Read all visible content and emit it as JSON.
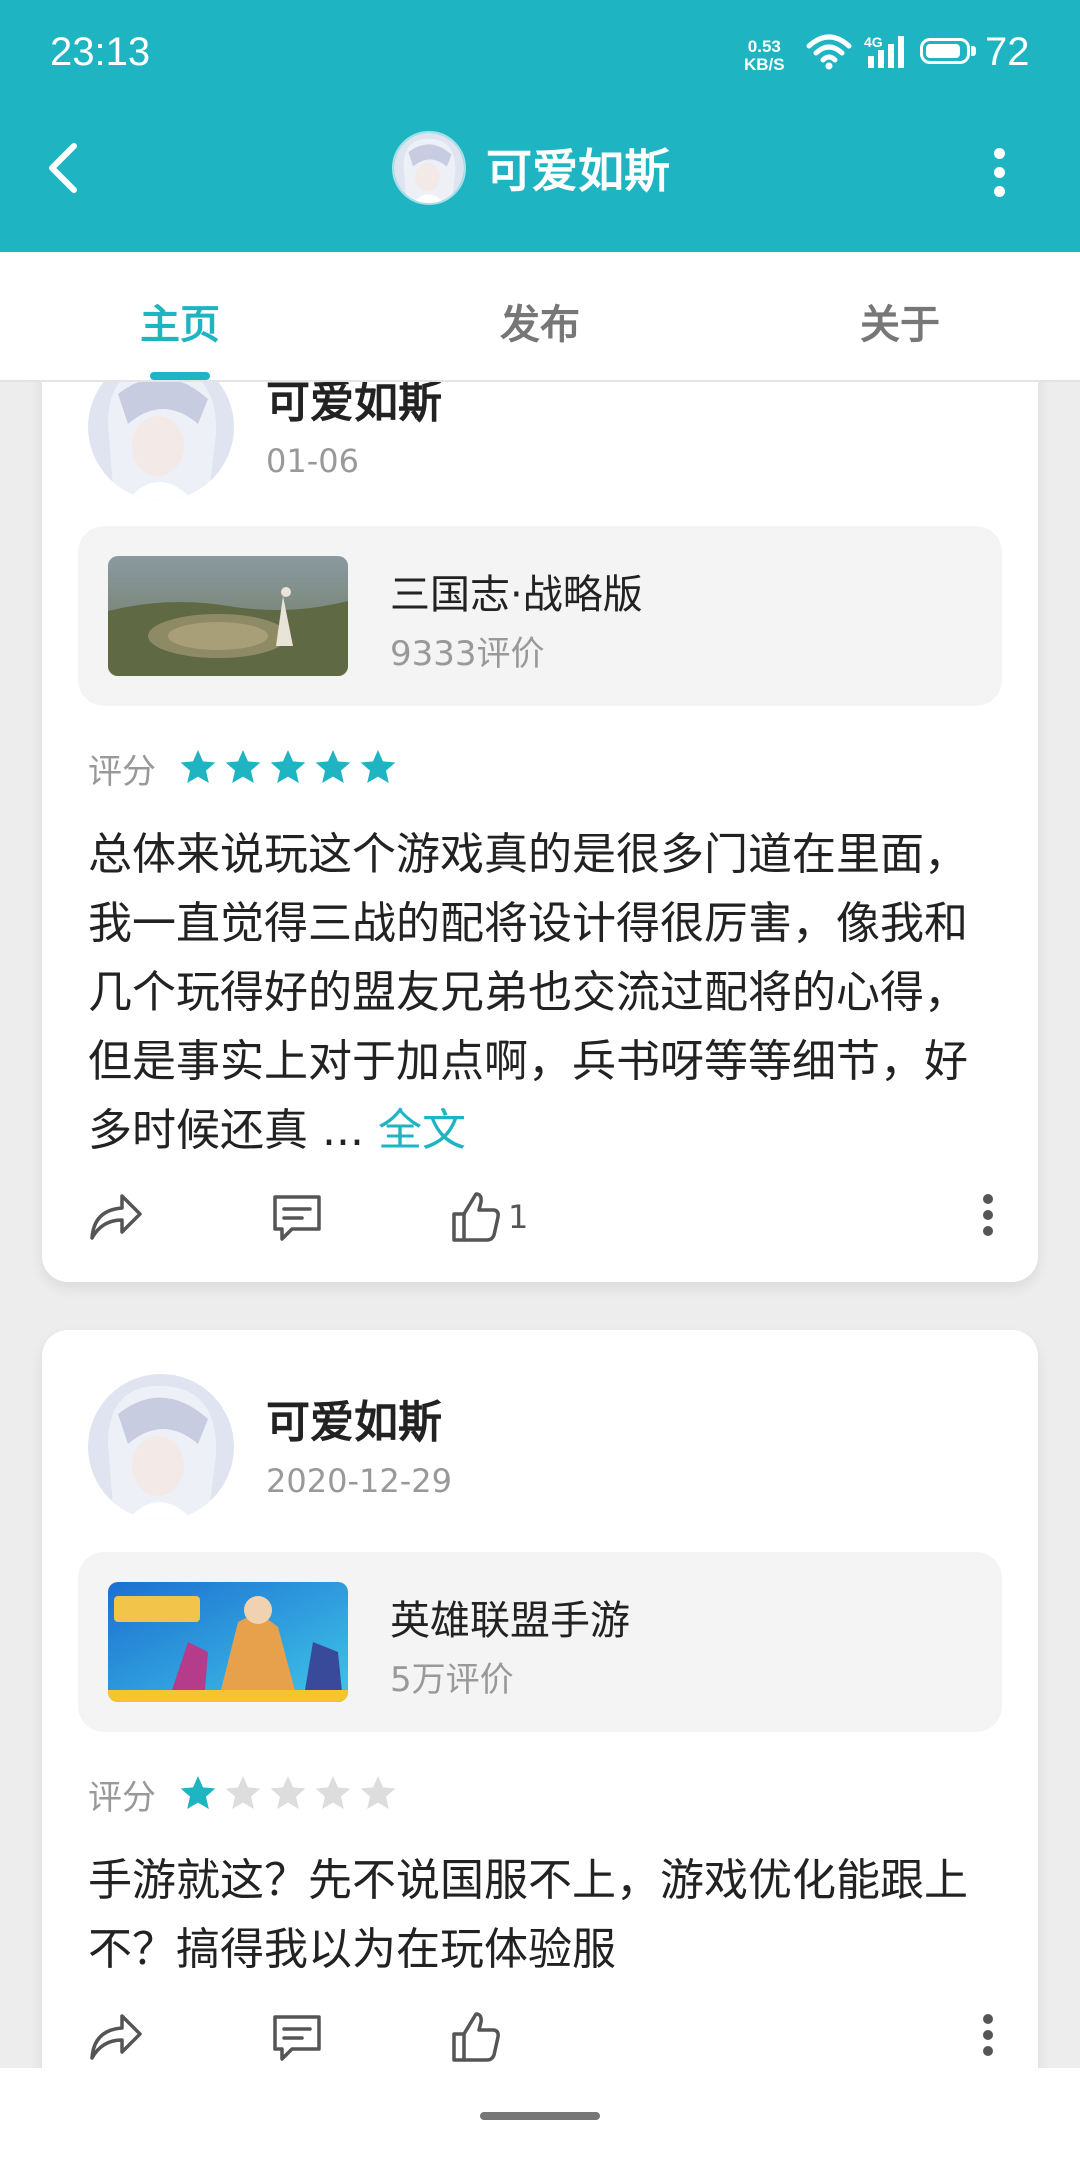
{
  "status_bar": {
    "time": "23:13",
    "net_speed_value": "0.53",
    "net_speed_unit": "KB/S",
    "network_type": "4G",
    "battery": "72"
  },
  "header": {
    "title": "可爱如斯",
    "back_icon": "back-arrow-icon",
    "more_icon": "more-vertical-icon"
  },
  "tabs": [
    {
      "label": "主页",
      "active": true
    },
    {
      "label": "发布",
      "active": false
    },
    {
      "label": "关于",
      "active": false
    }
  ],
  "reviews": [
    {
      "username": "可爱如斯",
      "date": "01-06",
      "game": {
        "name": "三国志·战略版",
        "review_count": "9333评价"
      },
      "rating_label": "评分",
      "rating": 5,
      "text": "总体来说玩这个游戏真的是很多门道在里面，我一直觉得三战的配将设计得很厉害，像我和几个玩得好的盟友兄弟也交流过配将的心得，但是事实上对于加点啊，兵书呀等等细节，好多时候还真 ...",
      "full_label": "全文",
      "likes": "1"
    },
    {
      "username": "可爱如斯",
      "date": "2020-12-29",
      "game": {
        "name": "英雄联盟手游",
        "review_count": "5万评价"
      },
      "rating_label": "评分",
      "rating": 1,
      "text": "手游就这？先不说国服不上，游戏优化能跟上不？搞得我以为在玩体验服",
      "likes": ""
    }
  ],
  "colors": {
    "accent": "#1fb4c2",
    "star_filled": "#1fb4c2",
    "star_empty": "#dddddd"
  }
}
